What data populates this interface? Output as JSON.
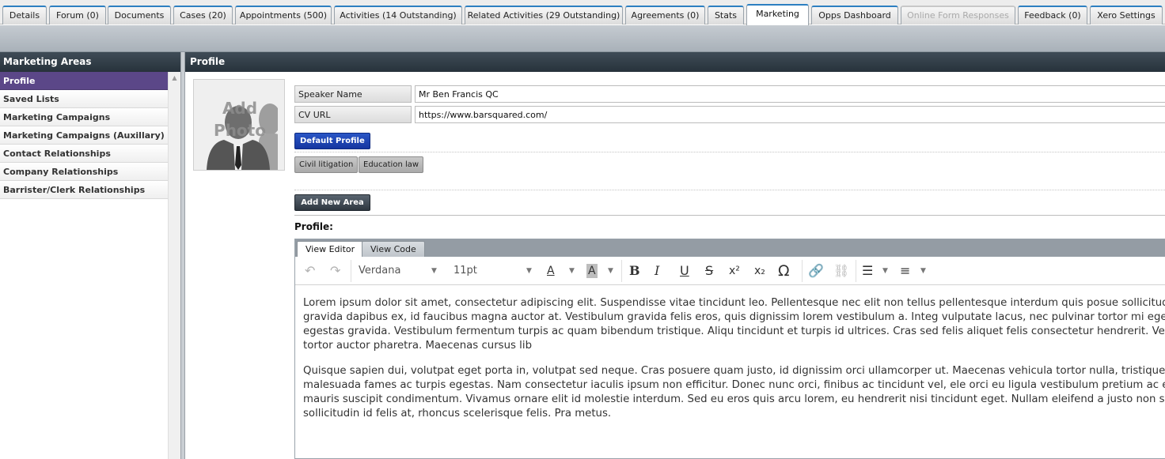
{
  "tabs": [
    {
      "label": "Details"
    },
    {
      "label": "Forum (0)"
    },
    {
      "label": "Documents"
    },
    {
      "label": "Cases (20)"
    },
    {
      "label": "Appointments (500)"
    },
    {
      "label": "Activities (14 Outstanding)"
    },
    {
      "label": "Related Activities (29 Outstanding)"
    },
    {
      "label": "Agreements (0)"
    },
    {
      "label": "Stats"
    },
    {
      "label": "Marketing"
    },
    {
      "label": "Opps Dashboard"
    },
    {
      "label": "Online Form Responses"
    },
    {
      "label": "Feedback (0)"
    },
    {
      "label": "Xero Settings"
    }
  ],
  "sidebar": {
    "title": "Marketing Areas",
    "items": [
      {
        "label": "Profile"
      },
      {
        "label": "Saved Lists"
      },
      {
        "label": "Marketing Campaigns"
      },
      {
        "label": "Marketing Campaigns (Auxillary)"
      },
      {
        "label": "Contact Relationships"
      },
      {
        "label": "Company Relationships"
      },
      {
        "label": "Barrister/Clerk Relationships"
      }
    ]
  },
  "main": {
    "title": "Profile",
    "photo_label": "Add Photo",
    "fields": {
      "speaker_name_label": "Speaker Name",
      "speaker_name_value": "Mr Ben Francis QC",
      "cv_url_label": "CV URL",
      "cv_url_value": "https://www.barsquared.com/"
    },
    "default_profile_button": "Default Profile",
    "areas": [
      "Civil litigation",
      "Education law"
    ],
    "add_area_button": "Add New Area",
    "profile_label": "Profile:"
  },
  "editor": {
    "tabs": [
      "View Editor",
      "View Code"
    ],
    "font_family": "Verdana",
    "font_size": "11pt",
    "paragraphs": [
      "Lorem ipsum dolor sit amet, consectetur adipiscing elit. Suspendisse vitae tincidunt leo. Pellentesque nec elit non tellus pellentesque interdum quis posue sollicitudin lobortis leo. Curabitur gravida dapibus ex, id faucibus magna auctor at. Vestibulum gravida felis eros, quis dignissim lorem vestibulum a. Integ vulputate lacus, nec pulvinar tortor mi eget metus. In at tortor in magna egestas gravida. Vestibulum fermentum turpis ac quam bibendum tristique. Aliqu tincidunt et turpis id ultrices. Cras sed felis aliquet felis consectetur hendrerit. Vestibulum finibus neque mattis tortor auctor pharetra. Maecenas cursus lib",
      "Quisque sapien dui, volutpat eget porta in, volutpat sed neque. Cras posuere quam justo, id dignissim orci ullamcorper ut. Maecenas vehicula tortor nulla, tristique senectus et netus et malesuada fames ac turpis egestas. Nam consectetur iaculis ipsum non efficitur. Donec nunc orci, finibus ac tincidunt vel, ele orci eu ligula vestibulum pretium ac eget libero. Sed id velit non mauris suscipit condimentum. Vivamus ornare elit id molestie interdum. Sed eu eros quis arcu lorem, eu hendrerit nisi tincidunt eget. Nullam eleifend a justo non sodales. Quisque metus turpis, sollicitudin id felis at, rhoncus scelerisque felis. Pra metus."
    ]
  },
  "icons": {
    "undo": "undo-icon",
    "redo": "redo-icon",
    "bold": "bold-icon",
    "italic": "italic-icon",
    "underline": "underline-icon",
    "strikethrough": "strikethrough-icon",
    "superscript": "superscript-icon",
    "subscript": "subscript-icon",
    "special_char": "omega-icon",
    "link": "link-icon",
    "unlink": "unlink-icon",
    "bullet_list": "bullet-list-icon",
    "numbered_list": "numbered-list-icon"
  },
  "colors": {
    "tab_accent": "#2d7fc1",
    "sidebar_active": "#5b4788",
    "default_profile_button": "#1536a0",
    "panel_header": "#2f3b45"
  }
}
